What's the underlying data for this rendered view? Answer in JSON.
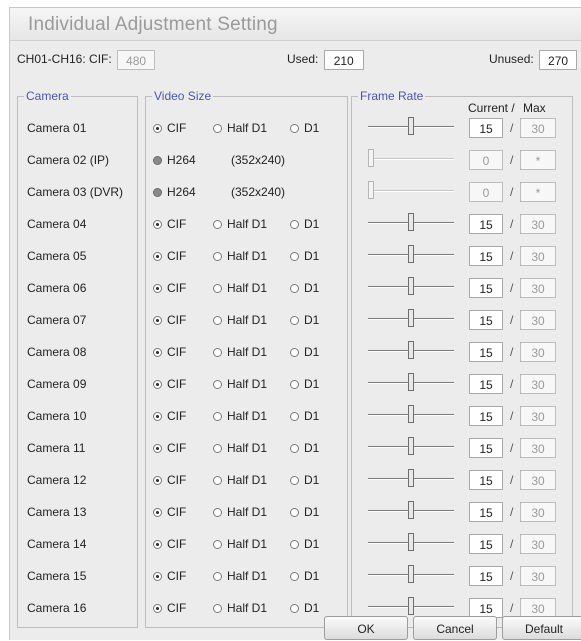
{
  "title": "Individual Adjustment Setting",
  "summary": {
    "range_label": "CH01-CH16: CIF:",
    "cif_value": "480",
    "used_label": "Used:",
    "used_value": "210",
    "unused_label": "Unused:",
    "unused_value": "270"
  },
  "groups": {
    "camera": "Camera",
    "video_size": "Video Size",
    "frame_rate": "Frame Rate",
    "current_label": "Current /",
    "max_label": "Max"
  },
  "size_options": [
    "CIF",
    "Half D1",
    "D1"
  ],
  "cameras": [
    {
      "name": "Camera 01",
      "type": "radio",
      "selected": "CIF",
      "current": "15",
      "max": "30",
      "level": 0.5,
      "enabled": true
    },
    {
      "name": "Camera 02 (IP)",
      "type": "codec",
      "codec": "H264",
      "resolution": "(352x240)",
      "current": "0",
      "max": "*",
      "level": 0,
      "enabled": false
    },
    {
      "name": "Camera 03 (DVR)",
      "type": "codec",
      "codec": "H264",
      "resolution": "(352x240)",
      "current": "0",
      "max": "*",
      "level": 0,
      "enabled": false
    },
    {
      "name": "Camera 04",
      "type": "radio",
      "selected": "CIF",
      "current": "15",
      "max": "30",
      "level": 0.5,
      "enabled": true
    },
    {
      "name": "Camera 05",
      "type": "radio",
      "selected": "CIF",
      "current": "15",
      "max": "30",
      "level": 0.5,
      "enabled": true
    },
    {
      "name": "Camera 06",
      "type": "radio",
      "selected": "CIF",
      "current": "15",
      "max": "30",
      "level": 0.5,
      "enabled": true
    },
    {
      "name": "Camera 07",
      "type": "radio",
      "selected": "CIF",
      "current": "15",
      "max": "30",
      "level": 0.5,
      "enabled": true
    },
    {
      "name": "Camera 08",
      "type": "radio",
      "selected": "CIF",
      "current": "15",
      "max": "30",
      "level": 0.5,
      "enabled": true
    },
    {
      "name": "Camera 09",
      "type": "radio",
      "selected": "CIF",
      "current": "15",
      "max": "30",
      "level": 0.5,
      "enabled": true
    },
    {
      "name": "Camera 10",
      "type": "radio",
      "selected": "CIF",
      "current": "15",
      "max": "30",
      "level": 0.5,
      "enabled": true
    },
    {
      "name": "Camera 11",
      "type": "radio",
      "selected": "CIF",
      "current": "15",
      "max": "30",
      "level": 0.5,
      "enabled": true
    },
    {
      "name": "Camera 12",
      "type": "radio",
      "selected": "CIF",
      "current": "15",
      "max": "30",
      "level": 0.5,
      "enabled": true
    },
    {
      "name": "Camera 13",
      "type": "radio",
      "selected": "CIF",
      "current": "15",
      "max": "30",
      "level": 0.5,
      "enabled": true
    },
    {
      "name": "Camera 14",
      "type": "radio",
      "selected": "CIF",
      "current": "15",
      "max": "30",
      "level": 0.5,
      "enabled": true
    },
    {
      "name": "Camera 15",
      "type": "radio",
      "selected": "CIF",
      "current": "15",
      "max": "30",
      "level": 0.5,
      "enabled": true
    },
    {
      "name": "Camera 16",
      "type": "radio",
      "selected": "CIF",
      "current": "15",
      "max": "30",
      "level": 0.5,
      "enabled": true
    }
  ],
  "buttons": {
    "ok": "OK",
    "cancel": "Cancel",
    "default": "Default"
  }
}
